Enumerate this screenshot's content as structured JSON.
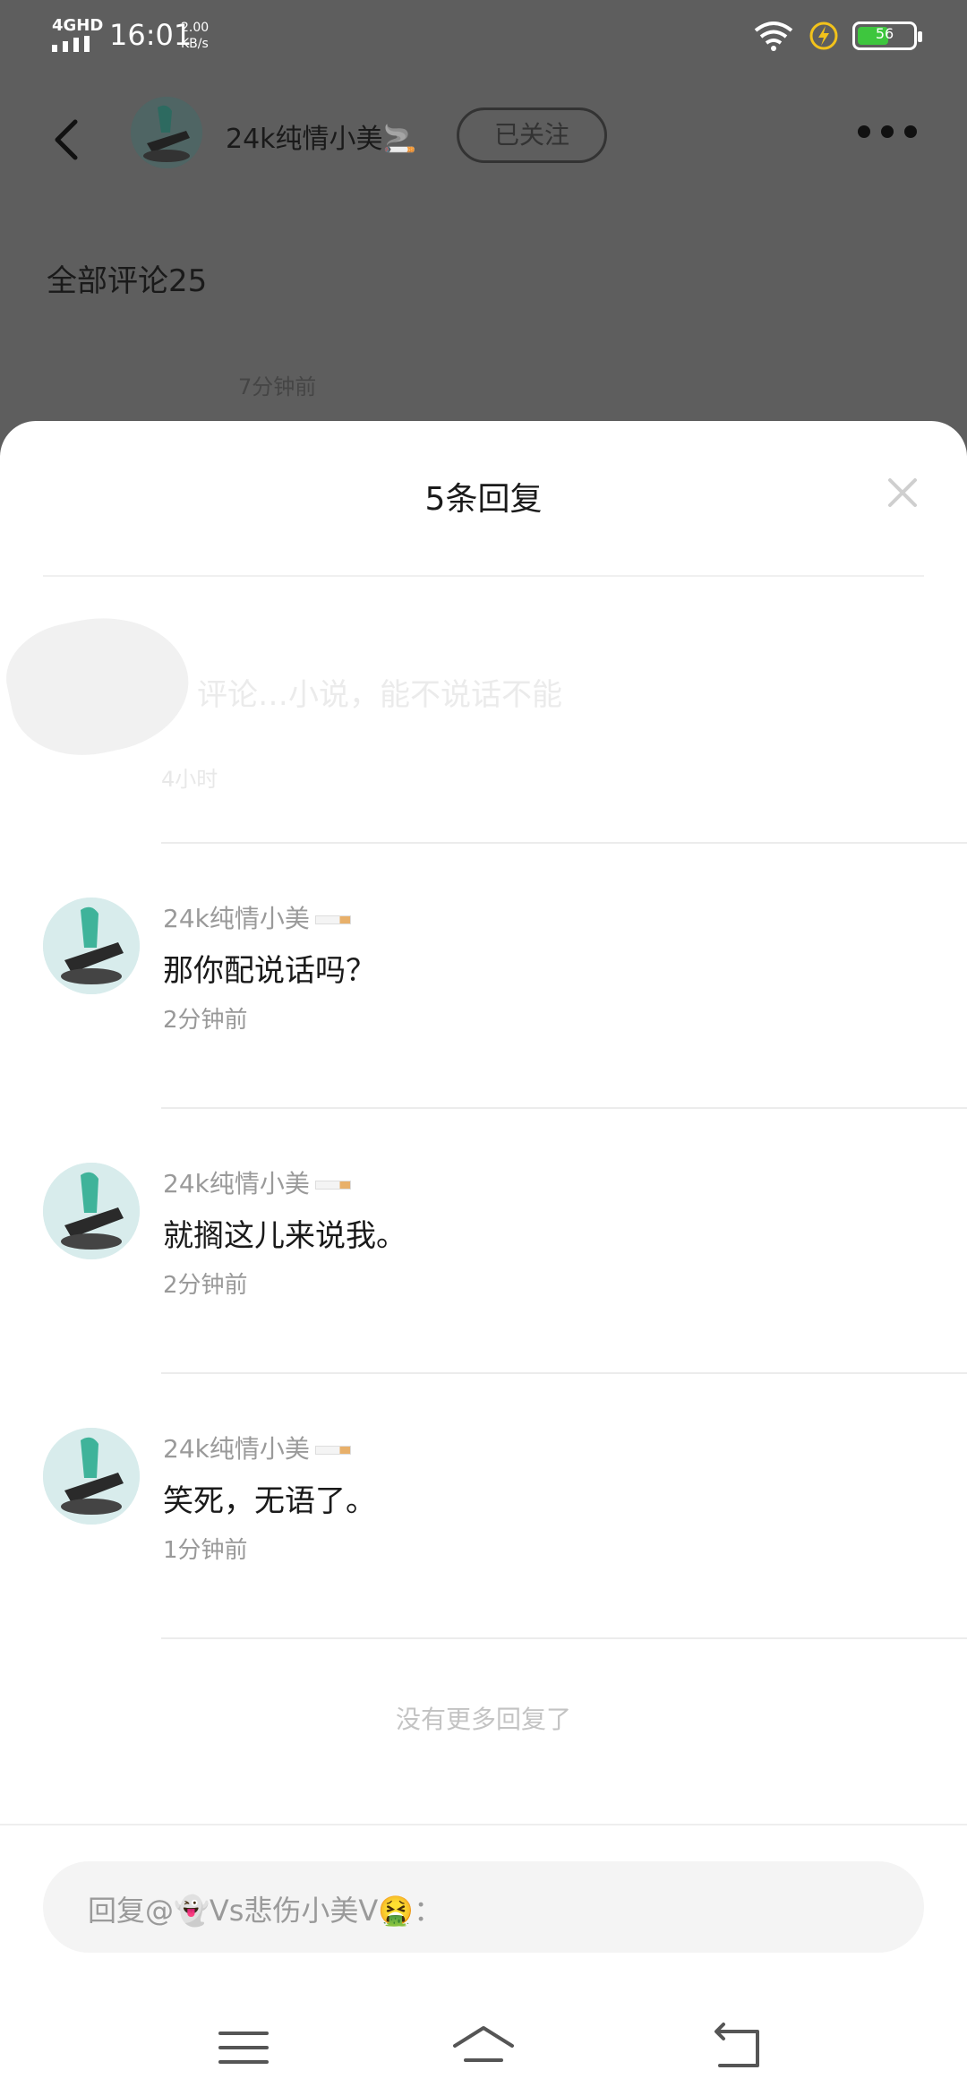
{
  "status_bar": {
    "network": "4GHD",
    "time": "16:01",
    "speed": "2.00 KB/s",
    "battery": "56",
    "battery_level": 0.56
  },
  "top_bar": {
    "username": "24k纯情小美🚬",
    "follow_label": "已关注"
  },
  "page": {
    "all_comments": "全部评论25",
    "background_time": "7分钟前"
  },
  "sheet": {
    "title": "5条回复",
    "faded_reply": {
      "text": "评论…小说，能不说话不能",
      "time": "4小时"
    },
    "replies": [
      {
        "name": "24k纯情小美",
        "text": "那你配说话吗？",
        "time": "2分钟前"
      },
      {
        "name": "24k纯情小美",
        "text": "就搁这儿来说我。",
        "time": "2分钟前"
      },
      {
        "name": "24k纯情小美",
        "text": "笑死，无语了。",
        "time": "1分钟前"
      }
    ],
    "no_more": "没有更多回复了",
    "input_placeholder": "回复@👻Vs悲伤小美V🤮："
  },
  "colors": {
    "accent_battery": "#3ec63e",
    "charging": "#f2c21b",
    "overlay": "#5e5e5e"
  }
}
